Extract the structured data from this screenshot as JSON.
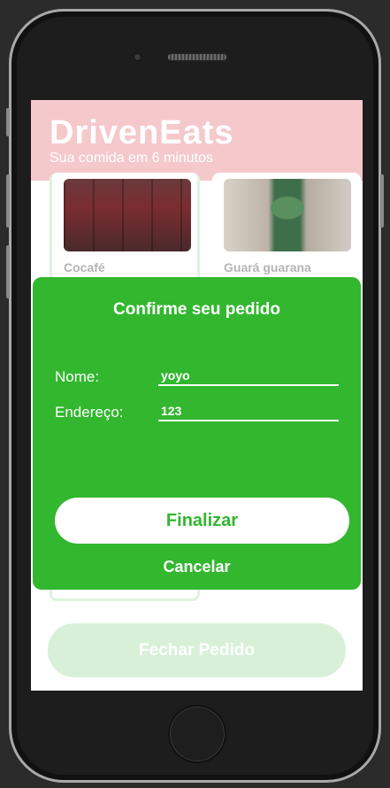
{
  "app": {
    "brand": "DrivenEats",
    "tagline": "Sua comida em 6 minutos"
  },
  "products": [
    {
      "name": "Cocafé",
      "image": "energy-cans"
    },
    {
      "name": "Guará guarana",
      "image": "guarana-bottle"
    }
  ],
  "modal": {
    "title": "Confirme seu pedido",
    "name_label": "Nome:",
    "name_value": "yoyo",
    "address_label": "Endereço:",
    "address_value": "123",
    "confirm_label": "Finalizar",
    "cancel_label": "Cancelar"
  },
  "footer": {
    "close_order_label": "Fechar Pedido"
  },
  "colors": {
    "header_bg": "#f5c9cc",
    "accent_green": "#32b72f",
    "disabled_button": "#d8f0d8"
  }
}
